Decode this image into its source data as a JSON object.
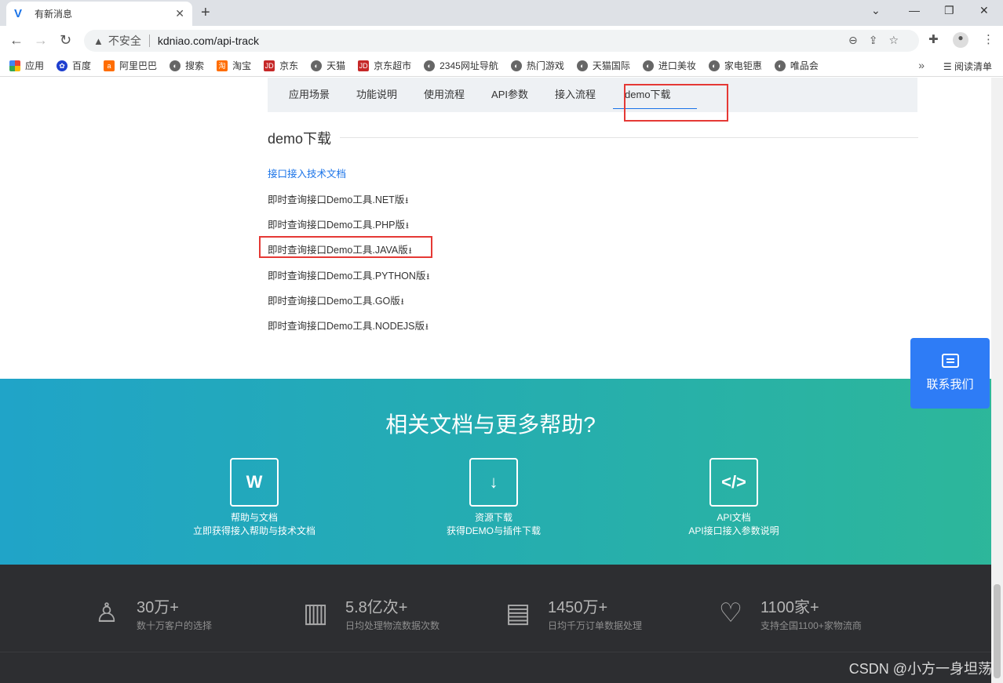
{
  "browser": {
    "tab_title": "有新消息",
    "insecure_label": "不安全",
    "url": "kdniao.com/api-track",
    "bookmarks": [
      "应用",
      "百度",
      "阿里巴巴",
      "搜索",
      "淘宝",
      "京东",
      "天猫",
      "京东超市",
      "2345网址导航",
      "热门游戏",
      "天猫国际",
      "进口美妆",
      "家电钜惠",
      "唯品会"
    ],
    "reading_list": "阅读清单"
  },
  "subnav": {
    "items": [
      "应用场景",
      "功能说明",
      "使用流程",
      "API参数",
      "接入流程",
      "demo下载"
    ]
  },
  "section": {
    "title": "demo下载",
    "doc_link": "接口接入技术文档",
    "downloads": [
      "即时查询接口Demo工具.NET版",
      "即时查询接口Demo工具.PHP版",
      "即时查询接口Demo工具.JAVA版",
      "即时查询接口Demo工具.PYTHON版",
      "即时查询接口Demo工具.GO版",
      "即时查询接口Demo工具.NODEJS版"
    ]
  },
  "contact": {
    "label": "联系我们"
  },
  "help": {
    "title": "相关文档与更多帮助?",
    "cards": [
      {
        "icon": "W",
        "title": "帮助与文档",
        "subtitle": "立即获得接入帮助与技术文档"
      },
      {
        "icon": "↓",
        "title": "资源下载",
        "subtitle": "获得DEMO与插件下载"
      },
      {
        "icon": "</>",
        "title": "API文档",
        "subtitle": "API接口接入参数说明"
      }
    ]
  },
  "stats": [
    {
      "num": "30万+",
      "desc": "数十万客户的选择"
    },
    {
      "num": "5.8亿次+",
      "desc": "日均处理物流数据次数"
    },
    {
      "num": "1450万+",
      "desc": "日均千万订单数据处理"
    },
    {
      "num": "1100家+",
      "desc": "支持全国1100+家物流商"
    }
  ],
  "watermark": "CSDN @小方一身坦荡"
}
